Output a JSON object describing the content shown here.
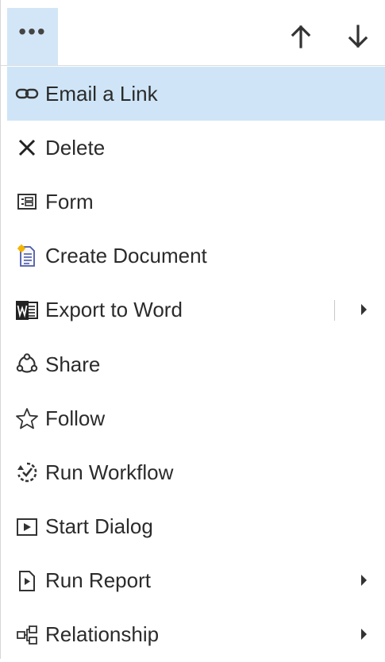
{
  "toolbar": {
    "more_label": "•••",
    "up_icon": "arrow-up-icon",
    "down_icon": "arrow-down-icon"
  },
  "menu": {
    "items": [
      {
        "label": "Email a Link",
        "icon": "link-icon",
        "highlighted": true,
        "submenu": false
      },
      {
        "label": "Delete",
        "icon": "close-icon",
        "highlighted": false,
        "submenu": false
      },
      {
        "label": "Form",
        "icon": "form-icon",
        "highlighted": false,
        "submenu": false
      },
      {
        "label": "Create Document",
        "icon": "document-icon",
        "highlighted": false,
        "submenu": false
      },
      {
        "label": "Export to Word",
        "icon": "word-icon",
        "highlighted": false,
        "submenu": true
      },
      {
        "label": "Share",
        "icon": "share-icon",
        "highlighted": false,
        "submenu": false
      },
      {
        "label": "Follow",
        "icon": "star-icon",
        "highlighted": false,
        "submenu": false
      },
      {
        "label": "Run Workflow",
        "icon": "workflow-icon",
        "highlighted": false,
        "submenu": false
      },
      {
        "label": "Start Dialog",
        "icon": "dialog-icon",
        "highlighted": false,
        "submenu": false
      },
      {
        "label": "Run Report",
        "icon": "report-icon",
        "highlighted": false,
        "submenu": true
      },
      {
        "label": "Relationship",
        "icon": "relationship-icon",
        "highlighted": false,
        "submenu": true
      }
    ]
  },
  "colors": {
    "highlight": "#cfe5f7",
    "more_button_bg": "#d3e6f7",
    "text": "#2b2b2b"
  }
}
